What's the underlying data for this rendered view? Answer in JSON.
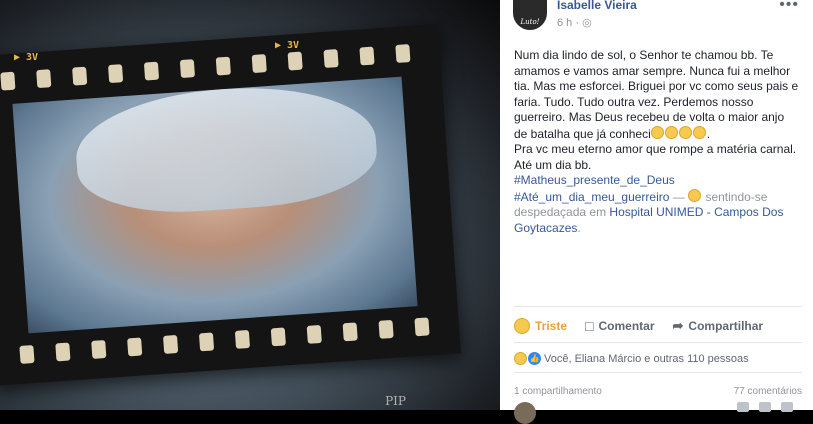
{
  "photo": {
    "film_label_left": "▶ 3V",
    "film_label_right": "▶ 3V",
    "watermark": "PIP"
  },
  "post": {
    "author": "Isabelle Vieira",
    "avatar_text": "Luto!",
    "time": "6 h",
    "privacy_icon": "globe-icon",
    "more_label": "•••",
    "text_lines": [
      "Num dia lindo de sol, o Senhor te chamou bb. Te amamos e vamos amar sempre. Nunca fui a melhor tia. Mas me esforcei. Briguei por vc como seus pais e faria. Tudo. Tudo outra vez. Perdemos nosso guerreiro. Mas Deus recebeu de volta o maior anjo de batalha que já conheci",
      "Pra vc meu eterno amor que rompe a matéria carnal. Até um dia bb."
    ],
    "hashtag1": "#Matheus_presente_de_Deus",
    "hashtag2": "#Até_um_dia_meu_guerreiro",
    "feeling_sep": " — ",
    "feeling_text": " sentindo-se despedaçada em ",
    "location": "Hospital UNIMED - Campos Dos Goytacazes",
    "location_end": "."
  },
  "actions": {
    "triste": "Triste",
    "comment": "Comentar",
    "share": "Compartilhar"
  },
  "reactions_summary": "Você, Eliana Márcio e outras 110 pessoas",
  "shares": "1 compartilhamento",
  "comments": "77 comentários",
  "colors": {
    "link": "#365899",
    "triste": "#e9a23b"
  }
}
